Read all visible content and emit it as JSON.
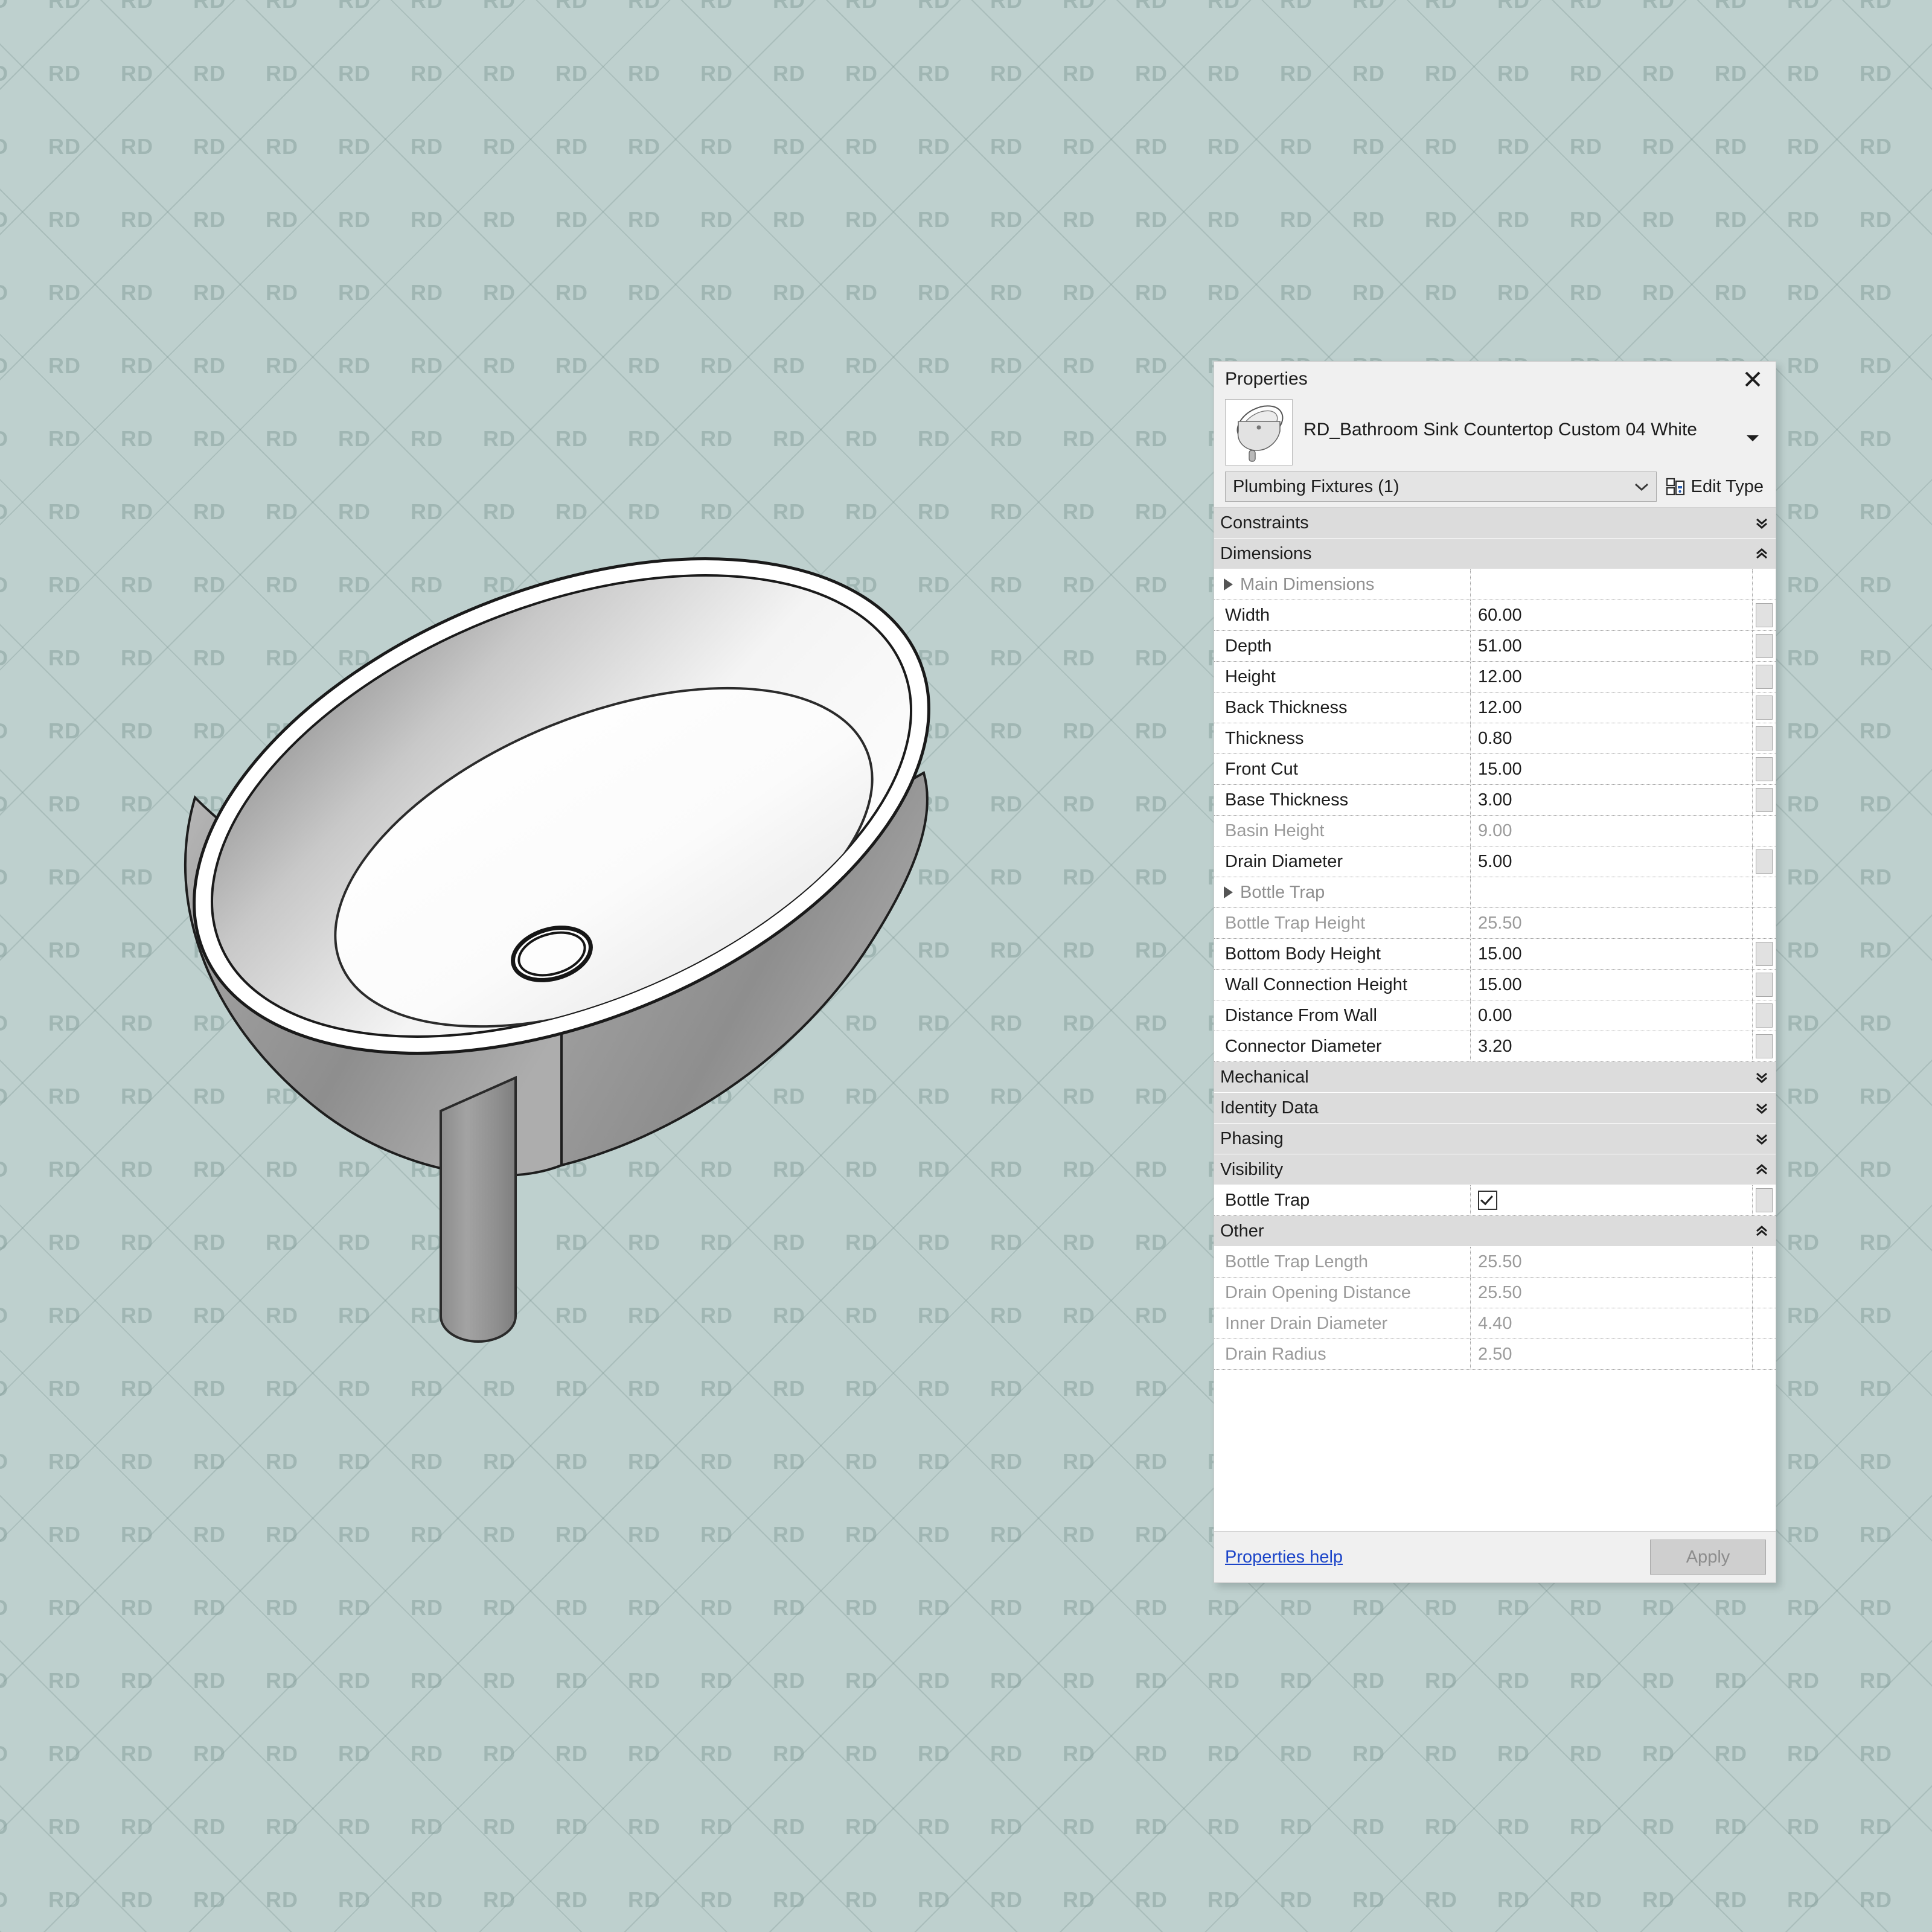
{
  "background": {
    "color": "#bed0ce",
    "watermark_text": "RD",
    "watermark_color": "#78918e"
  },
  "viewport": {
    "model_name": "bathroom-sink-countertop-3d-view"
  },
  "palette": {
    "title": "Properties",
    "close_label": "×",
    "type_name": "RD_Bathroom Sink Countertop Custom 04 White",
    "category_selector": {
      "value": "Plumbing Fixtures (1)"
    },
    "edit_type_label": "Edit Type",
    "footer": {
      "help_link": "Properties help",
      "apply_label": "Apply"
    },
    "sections": [
      {
        "name": "Constraints",
        "expanded": false,
        "rows": []
      },
      {
        "name": "Dimensions",
        "expanded": true,
        "rows": [
          {
            "label": "Main Dimensions",
            "value": "",
            "kind": "group",
            "disabled": true
          },
          {
            "label": "Width",
            "value": "60.00",
            "kind": "value",
            "disabled": false
          },
          {
            "label": "Depth",
            "value": "51.00",
            "kind": "value",
            "disabled": false
          },
          {
            "label": "Height",
            "value": "12.00",
            "kind": "value",
            "disabled": false
          },
          {
            "label": "Back Thickness",
            "value": "12.00",
            "kind": "value",
            "disabled": false
          },
          {
            "label": "Thickness",
            "value": "0.80",
            "kind": "value",
            "disabled": false
          },
          {
            "label": "Front Cut",
            "value": "15.00",
            "kind": "value",
            "disabled": false
          },
          {
            "label": "Base Thickness",
            "value": "3.00",
            "kind": "value",
            "disabled": false
          },
          {
            "label": "Basin Height",
            "value": "9.00",
            "kind": "value",
            "disabled": true
          },
          {
            "label": "Drain Diameter",
            "value": "5.00",
            "kind": "value",
            "disabled": false
          },
          {
            "label": "Bottle Trap",
            "value": "",
            "kind": "group",
            "disabled": true
          },
          {
            "label": "Bottle Trap Height",
            "value": "25.50",
            "kind": "value",
            "disabled": true
          },
          {
            "label": "Bottom Body Height",
            "value": "15.00",
            "kind": "value",
            "disabled": false
          },
          {
            "label": "Wall Connection Height",
            "value": "15.00",
            "kind": "value",
            "disabled": false
          },
          {
            "label": "Distance From Wall",
            "value": "0.00",
            "kind": "value",
            "disabled": false
          },
          {
            "label": "Connector Diameter",
            "value": "3.20",
            "kind": "value",
            "disabled": false
          }
        ]
      },
      {
        "name": "Mechanical",
        "expanded": false,
        "rows": []
      },
      {
        "name": "Identity Data",
        "expanded": false,
        "rows": []
      },
      {
        "name": "Phasing",
        "expanded": false,
        "rows": []
      },
      {
        "name": "Visibility",
        "expanded": true,
        "rows": [
          {
            "label": "Bottle Trap",
            "value": "",
            "kind": "checkbox",
            "checked": true,
            "disabled": false
          }
        ]
      },
      {
        "name": "Other",
        "expanded": true,
        "rows": [
          {
            "label": "Bottle Trap Length",
            "value": "25.50",
            "kind": "value",
            "disabled": true
          },
          {
            "label": "Drain Opening Distance",
            "value": "25.50",
            "kind": "value",
            "disabled": true
          },
          {
            "label": "Inner Drain Diameter",
            "value": "4.40",
            "kind": "value",
            "disabled": true
          },
          {
            "label": "Drain Radius",
            "value": "2.50",
            "kind": "value",
            "disabled": true
          }
        ]
      }
    ]
  }
}
